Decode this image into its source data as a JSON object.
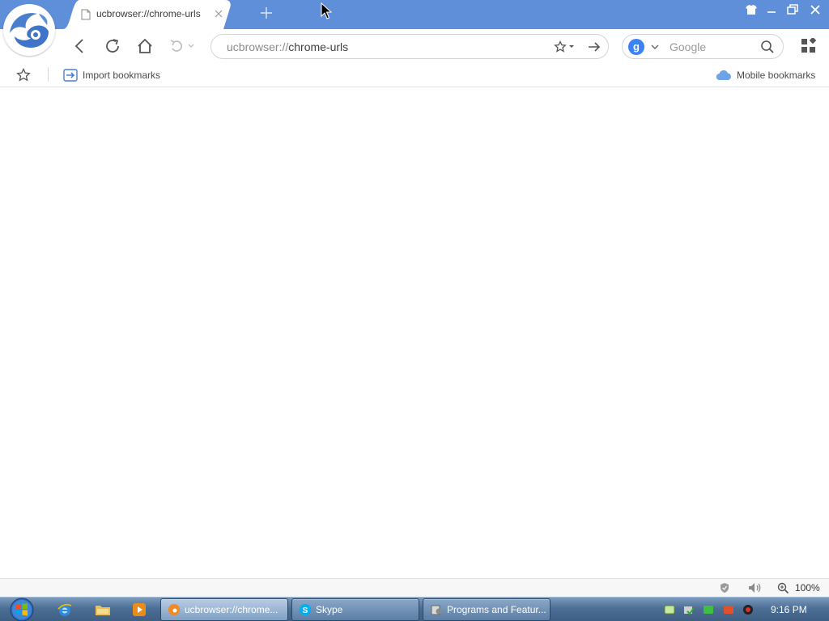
{
  "browser": {
    "tab": {
      "title": "ucbrowser://chrome-urls"
    },
    "address": {
      "url": "ucbrowser://chrome-urls"
    },
    "search": {
      "engine_icon": "g",
      "placeholder": "Google"
    },
    "bookmarks": {
      "import_label": "Import bookmarks",
      "mobile_label": "Mobile bookmarks"
    },
    "status": {
      "zoom": "100%"
    },
    "icons": [
      "uc-logo-icon",
      "page-icon",
      "close-icon",
      "plus-icon",
      "skin-icon",
      "minimize-icon",
      "maximize-icon",
      "back-icon",
      "reload-icon",
      "home-icon",
      "undo-icon",
      "star-icon",
      "arrow-right-icon",
      "search-icon",
      "apps-icon",
      "import-icon",
      "cloud-icon",
      "shield-icon",
      "volume-icon",
      "zoom-icon"
    ],
    "colors": {
      "titlebar": "#5f8fd9",
      "accent": "#3b82f6"
    }
  },
  "taskbar": {
    "tasks": [
      {
        "label": "ucbrowser://chrome..."
      },
      {
        "label": "Skype"
      },
      {
        "label": "Programs and Featur..."
      }
    ],
    "clock": "9:16 PM"
  }
}
